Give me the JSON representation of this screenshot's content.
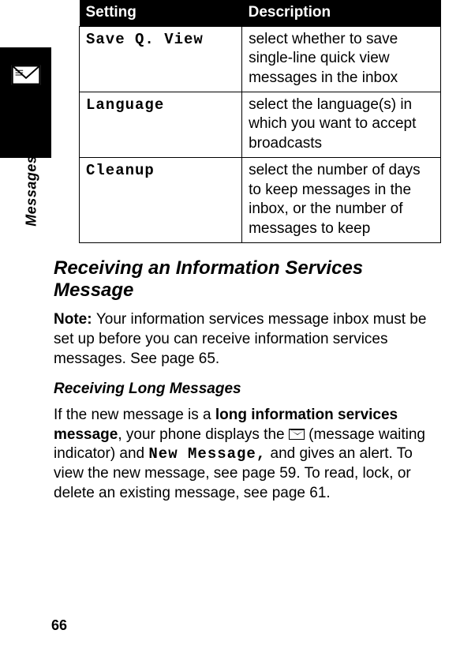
{
  "side_label": "Messages",
  "table": {
    "headers": [
      "Setting",
      "Description"
    ],
    "rows": [
      {
        "setting": "Save Q. View",
        "desc": "select whether to save single-line quick view messages in the inbox"
      },
      {
        "setting": "Language",
        "desc": "select the language(s) in which you want to accept broadcasts"
      },
      {
        "setting": "Cleanup",
        "desc": "select the number of days to keep messages in the inbox, or the number of messages to keep"
      }
    ]
  },
  "section1_title": "Receiving an Information Services Message",
  "note_prefix": "Note: ",
  "note_body": "Your information services message inbox must be set up before you can receive information services messages. See page 65.",
  "sub_title": "Receiving Long Messages",
  "para_pre": "If the new message is a ",
  "para_bold": "long information services message",
  "para_mid1": ", your phone displays the ",
  "para_mid2": " (message waiting indicator) and ",
  "para_mono": "New Message,",
  "para_end": " and gives an alert. To view the new message, see page 59. To read, lock, or delete an existing message, see page 61.",
  "page_number": "66"
}
